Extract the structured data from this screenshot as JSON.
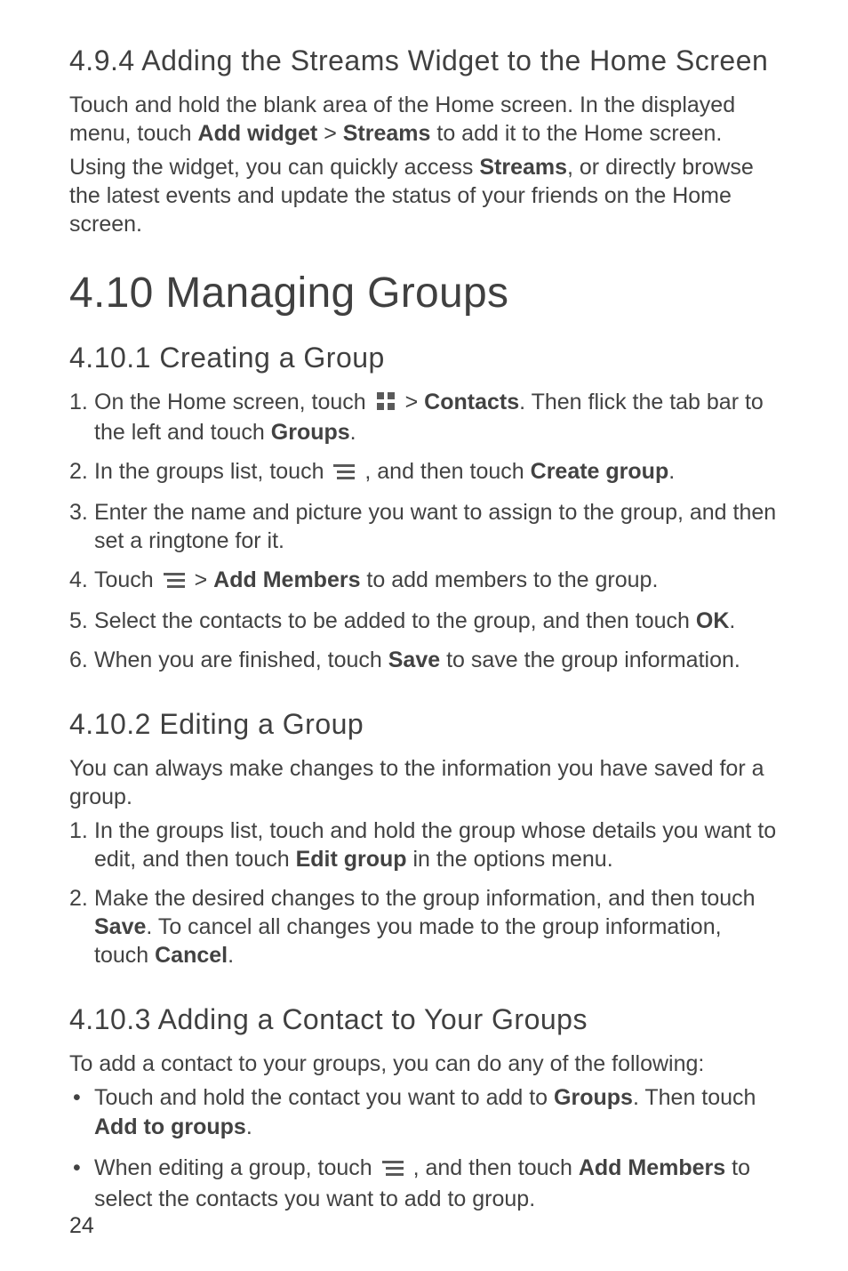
{
  "section494": {
    "heading": "4.9.4  Adding the Streams Widget to the Home Screen",
    "p1_a": "Touch and hold the blank area of the Home screen. In the displayed menu, touch ",
    "p1_b1": "Add widget",
    "p1_b2": " > ",
    "p1_b3": "Streams",
    "p1_b4": " to add it to the Home screen.",
    "p2_a": "Using the widget, you can quickly access ",
    "p2_b": "Streams",
    "p2_c": ", or directly browse the latest events and update the status of your friends on the Home screen."
  },
  "section410": {
    "heading": "4.10  Managing Groups"
  },
  "section4101": {
    "heading": "4.10.1  Creating a Group",
    "li1_a": "On the Home screen, touch ",
    "li1_b": " > ",
    "li1_c": "Contacts",
    "li1_d": ". Then flick the tab bar to the left and touch ",
    "li1_e": "Groups",
    "li1_f": ".",
    "li2_a": "In the groups list, touch ",
    "li2_b": " , and then touch ",
    "li2_c": "Create group",
    "li2_d": ".",
    "li3": "Enter the name and picture you want to assign to the group, and then set a ringtone for it.",
    "li4_a": "Touch ",
    "li4_b": " > ",
    "li4_c": "Add Members",
    "li4_d": " to add members to the group.",
    "li5_a": "Select the contacts to be added to the group, and then touch ",
    "li5_b": "OK",
    "li5_c": ".",
    "li6_a": "When you are finished, touch ",
    "li6_b": "Save",
    "li6_c": " to save the group information."
  },
  "section4102": {
    "heading": "4.10.2  Editing a Group",
    "p1": "You can always make changes to the information you have saved for a group.",
    "li1_a": "In the groups list, touch and hold the group whose details you want to edit, and then touch ",
    "li1_b": "Edit group",
    "li1_c": " in the options menu.",
    "li2_a": "Make the desired changes to the group information, and then touch ",
    "li2_b": "Save",
    "li2_c": ". To cancel all changes you made to the group information, touch ",
    "li2_d": "Cancel",
    "li2_e": "."
  },
  "section4103": {
    "heading": "4.10.3  Adding a Contact to Your Groups",
    "p1": "To add a contact to your groups, you can do any of the following:",
    "li1_a": "Touch and hold the contact you want to add to ",
    "li1_b": "Groups",
    "li1_c": ". Then touch ",
    "li1_d": "Add to groups",
    "li1_e": ".",
    "li2_a": "When editing a group, touch ",
    "li2_b": " , and then touch ",
    "li2_c": "Add Members",
    "li2_d": " to select the contacts you want to add to group."
  },
  "pagenum": "24"
}
